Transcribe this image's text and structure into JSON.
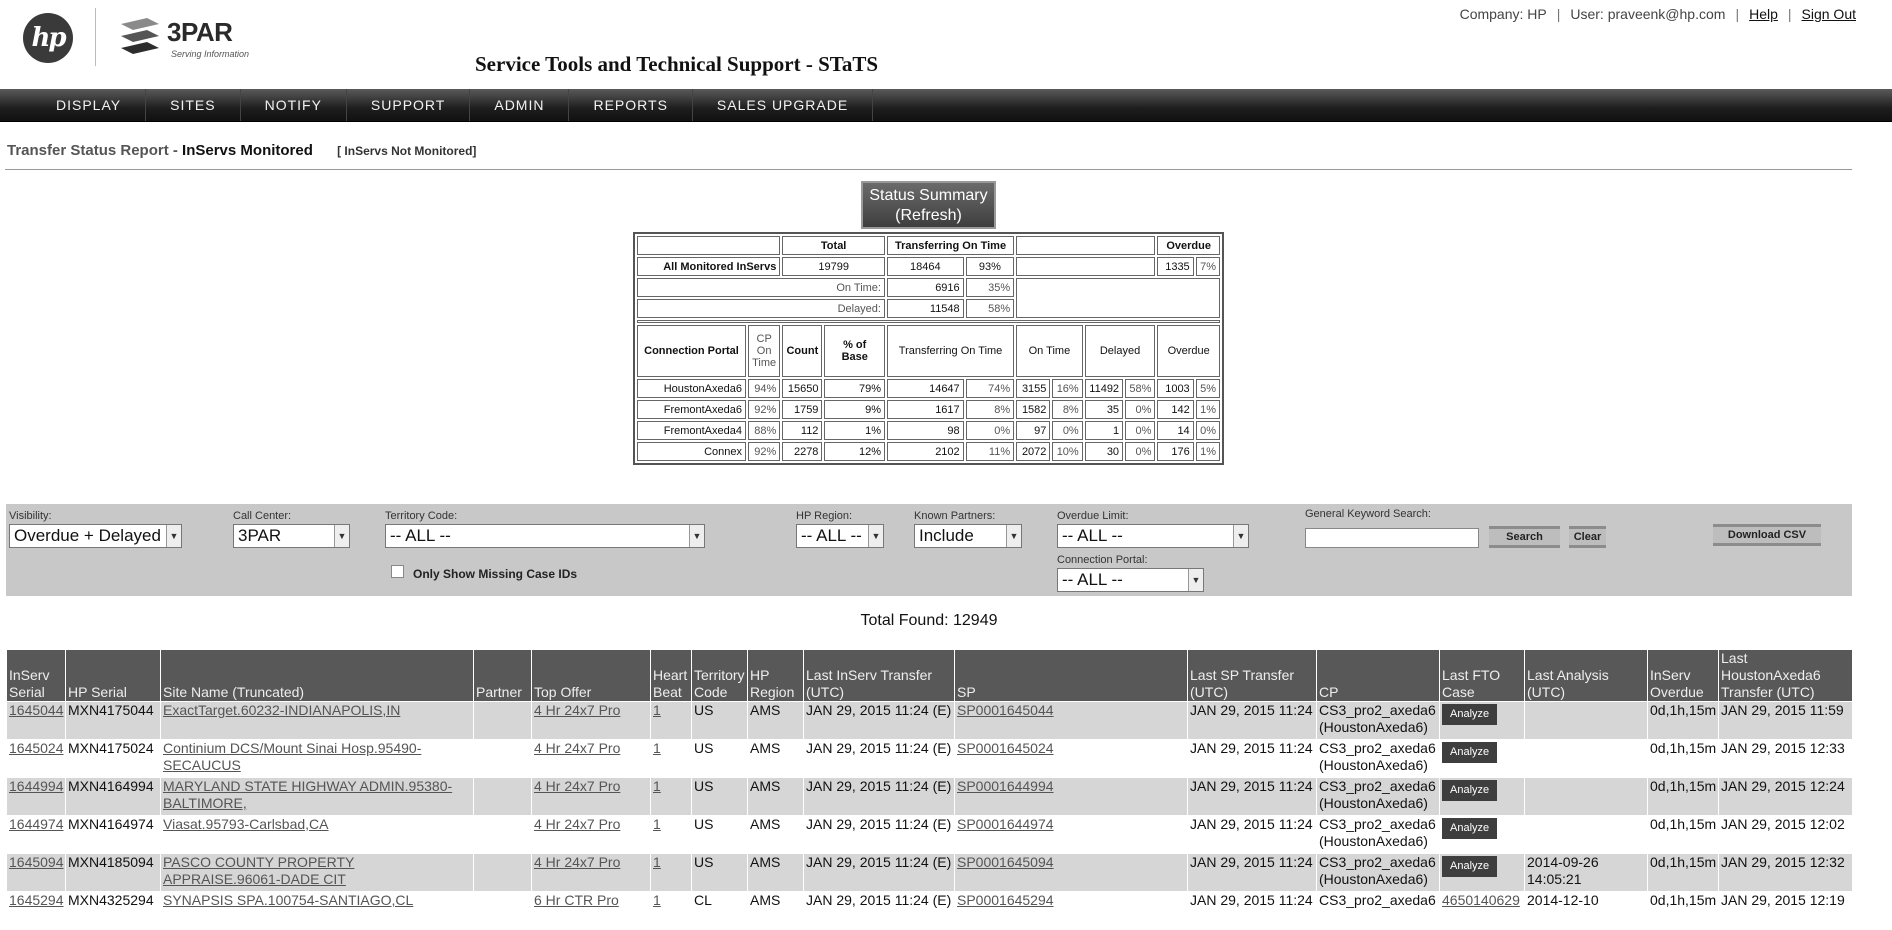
{
  "header": {
    "logo_hp": "hp",
    "logo_3par": "3PAR",
    "logo_3par_tagline": "Serving Information",
    "app_title": "Service Tools and Technical Support - STaTS",
    "company": "Company: HP",
    "user": "User: praveenk@hp.com",
    "help": "Help",
    "sign_out": "Sign Out"
  },
  "nav": {
    "items": [
      "DISPLAY",
      "SITES",
      "NOTIFY",
      "SUPPORT",
      "ADMIN",
      "REPORTS",
      "SALES UPGRADE"
    ]
  },
  "report": {
    "prefix": "Transfer Status Report - ",
    "title": "InServs Monitored",
    "alt_link": "[ InServs Not Monitored]"
  },
  "summary": {
    "refresh_button": "Status Summary (Refresh)",
    "hdr_total": "Total",
    "hdr_transferring": "Transferring On Time",
    "hdr_overdue": "Overdue",
    "all_label": "All Monitored InServs",
    "all_total": "19799",
    "all_transferring": "18464",
    "all_transferring_pct": "93%",
    "all_overdue": "1335",
    "all_overdue_pct": "7%",
    "ontime_label": "On Time:",
    "ontime_value": "6916",
    "ontime_pct": "35%",
    "delayed_label": "Delayed:",
    "delayed_value": "11548",
    "delayed_pct": "58%",
    "col_portal": "Connection Portal",
    "col_cp": "CP On Time",
    "col_count": "Count",
    "col_base": "% of Base",
    "col_transferring": "Transferring On Time",
    "col_ontime": "On Time",
    "col_delayed": "Delayed",
    "col_overdue": "Overdue",
    "portals": [
      {
        "name": "HoustonAxeda6",
        "cp": "94%",
        "count": "15650",
        "base": "79%",
        "trans": "14647",
        "trans_pct": "74%",
        "ontime": "3155",
        "ontime_pct": "16%",
        "delayed": "11492",
        "delayed_pct": "58%",
        "overdue": "1003",
        "overdue_pct": "5%"
      },
      {
        "name": "FremontAxeda6",
        "cp": "92%",
        "count": "1759",
        "base": "9%",
        "trans": "1617",
        "trans_pct": "8%",
        "ontime": "1582",
        "ontime_pct": "8%",
        "delayed": "35",
        "delayed_pct": "0%",
        "overdue": "142",
        "overdue_pct": "1%"
      },
      {
        "name": "FremontAxeda4",
        "cp": "88%",
        "count": "112",
        "base": "1%",
        "trans": "98",
        "trans_pct": "0%",
        "ontime": "97",
        "ontime_pct": "0%",
        "delayed": "1",
        "delayed_pct": "0%",
        "overdue": "14",
        "overdue_pct": "0%"
      },
      {
        "name": "Connex",
        "cp": "92%",
        "count": "2278",
        "base": "12%",
        "trans": "2102",
        "trans_pct": "11%",
        "ontime": "2072",
        "ontime_pct": "10%",
        "delayed": "30",
        "delayed_pct": "0%",
        "overdue": "176",
        "overdue_pct": "1%"
      }
    ]
  },
  "filters": {
    "visibility_label": "Visibility:",
    "visibility_value": "Overdue + Delayed",
    "call_center_label": "Call Center:",
    "call_center_value": "3PAR",
    "territory_label": "Territory Code:",
    "territory_value": "-- ALL --",
    "missing_case_label": "Only Show Missing Case IDs",
    "hp_region_label": "HP Region:",
    "hp_region_value": "-- ALL --",
    "partners_label": "Known Partners:",
    "partners_value": "Include",
    "overdue_limit_label": "Overdue Limit:",
    "overdue_limit_value": "-- ALL --",
    "portal_label": "Connection Portal:",
    "portal_value": "-- ALL --",
    "keyword_label": "General Keyword Search:",
    "keyword_value": "",
    "search_button": "Search",
    "clear_button": "Clear",
    "csv_button": "Download CSV"
  },
  "results": {
    "total_found": "Total Found: 12949",
    "columns": [
      "InServ Serial",
      "HP Serial",
      "Site Name (Truncated)",
      "Partner",
      "Top Offer",
      "Heart Beat",
      "Territory Code",
      "HP Region",
      "Last InServ Transfer (UTC)",
      "SP",
      "Last SP Transfer (UTC)",
      "CP",
      "Last FTO Case",
      "Last Analysis (UTC)",
      "InServ Overdue",
      "Last HoustonAxeda6 Transfer (UTC)"
    ],
    "rows": [
      {
        "inserv": "1645044",
        "hp_serial": "MXN4175044",
        "site": "ExactTarget.60232-INDIANAPOLIS,IN",
        "partner": "",
        "offer": "4 Hr 24x7 Pro",
        "heartbeat": "1",
        "territory": "US",
        "region": "AMS",
        "last_inserv": "JAN 29, 2015 11:24 (E)",
        "sp": "SP0001645044",
        "last_sp": "JAN 29, 2015 11:24",
        "cp": "CS3_pro2_axeda6 (HoustonAxeda6)",
        "fto": "Analyze",
        "analysis": "",
        "overdue": "0d,1h,15m",
        "last_houston": "JAN 29, 2015 11:59"
      },
      {
        "inserv": "1645024",
        "hp_serial": "MXN4175024",
        "site": "Continium DCS/Mount Sinai Hosp.95490-SECAUCUS",
        "partner": "",
        "offer": "4 Hr 24x7 Pro",
        "heartbeat": "1",
        "territory": "US",
        "region": "AMS",
        "last_inserv": "JAN 29, 2015 11:24 (E)",
        "sp": "SP0001645024",
        "last_sp": "JAN 29, 2015 11:24",
        "cp": "CS3_pro2_axeda6 (HoustonAxeda6)",
        "fto": "Analyze",
        "analysis": "",
        "overdue": "0d,1h,15m",
        "last_houston": "JAN 29, 2015 12:33"
      },
      {
        "inserv": "1644994",
        "hp_serial": "MXN4164994",
        "site": "MARYLAND STATE HIGHWAY ADMIN.95380-BALTIMORE,",
        "partner": "",
        "offer": "4 Hr 24x7 Pro",
        "heartbeat": "1",
        "territory": "US",
        "region": "AMS",
        "last_inserv": "JAN 29, 2015 11:24 (E)",
        "sp": "SP0001644994",
        "last_sp": "JAN 29, 2015 11:24",
        "cp": "CS3_pro2_axeda6 (HoustonAxeda6)",
        "fto": "Analyze",
        "analysis": "",
        "overdue": "0d,1h,15m",
        "last_houston": "JAN 29, 2015 12:24"
      },
      {
        "inserv": "1644974",
        "hp_serial": "MXN4164974",
        "site": "Viasat.95793-Carlsbad,CA",
        "partner": "",
        "offer": "4 Hr 24x7 Pro",
        "heartbeat": "1",
        "territory": "US",
        "region": "AMS",
        "last_inserv": "JAN 29, 2015 11:24 (E)",
        "sp": "SP0001644974",
        "last_sp": "JAN 29, 2015 11:24",
        "cp": "CS3_pro2_axeda6 (HoustonAxeda6)",
        "fto": "Analyze",
        "analysis": "",
        "overdue": "0d,1h,15m",
        "last_houston": "JAN 29, 2015 12:02"
      },
      {
        "inserv": "1645094",
        "hp_serial": "MXN4185094",
        "site": "PASCO COUNTY PROPERTY APPRAISE.96061-DADE CIT",
        "partner": "",
        "offer": "4 Hr 24x7 Pro",
        "heartbeat": "1",
        "territory": "US",
        "region": "AMS",
        "last_inserv": "JAN 29, 2015 11:24 (E)",
        "sp": "SP0001645094",
        "last_sp": "JAN 29, 2015 11:24",
        "cp": "CS3_pro2_axeda6 (HoustonAxeda6)",
        "fto": "Analyze",
        "analysis": "2014-09-26 14:05:21",
        "overdue": "0d,1h,15m",
        "last_houston": "JAN 29, 2015 12:32"
      },
      {
        "inserv": "1645294",
        "hp_serial": "MXN4325294",
        "site": "SYNAPSIS SPA.100754-SANTIAGO,CL",
        "partner": "",
        "offer": "6 Hr CTR Pro",
        "heartbeat": "1",
        "territory": "CL",
        "region": "AMS",
        "last_inserv": "JAN 29, 2015 11:24 (E)",
        "sp": "SP0001645294",
        "last_sp": "JAN 29, 2015 11:24",
        "cp": "CS3_pro2_axeda6",
        "fto": "4650140629",
        "analysis": "2014-12-10",
        "overdue": "0d,1h,15m",
        "last_houston": "JAN 29, 2015 12:19"
      }
    ]
  }
}
